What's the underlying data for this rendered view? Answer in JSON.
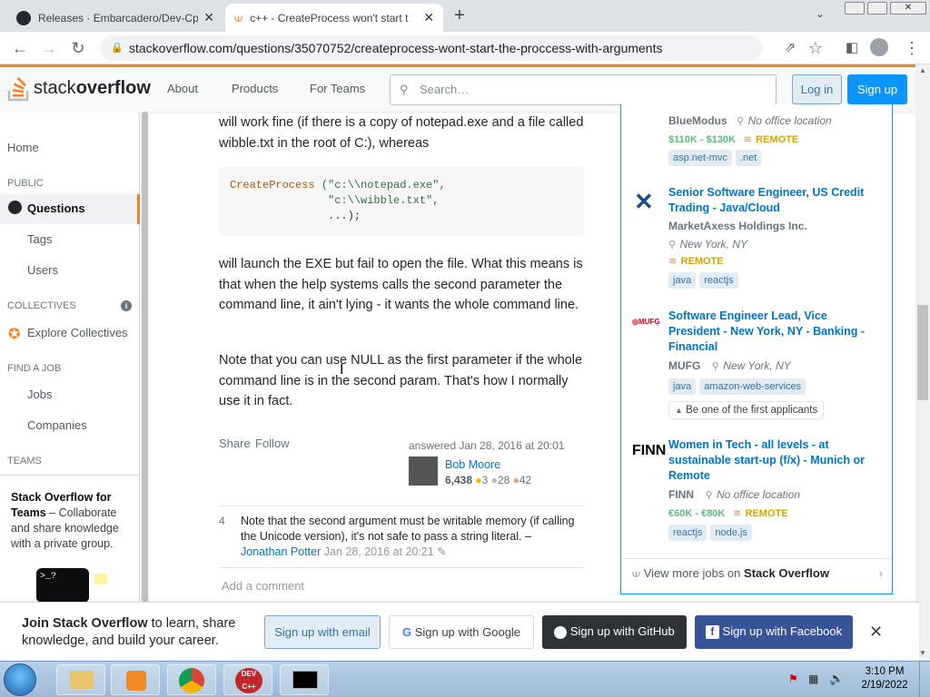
{
  "browser": {
    "tabs": [
      {
        "title": "Releases · Embarcadero/Dev-Cpp"
      },
      {
        "title": "c++ - CreateProcess won't start t"
      }
    ],
    "url": "stackoverflow.com/questions/35070752/createprocess-wont-start-the-proccess-with-arguments"
  },
  "so_header": {
    "logo_a": "stack",
    "logo_b": "overflow",
    "nav": [
      "About",
      "Products",
      "For Teams"
    ],
    "search_placeholder": "Search…",
    "login": "Log in",
    "signup": "Sign up"
  },
  "left_nav": {
    "home": "Home",
    "public": "PUBLIC",
    "questions": "Questions",
    "tags": "Tags",
    "users": "Users",
    "collectives": "COLLECTIVES",
    "explore": "Explore Collectives",
    "find_job": "FIND A JOB",
    "jobs": "Jobs",
    "companies": "Companies",
    "teams": "TEAMS",
    "teams_title": "Stack Overflow for Teams",
    "teams_desc": " – Collaborate and share knowledge with a private group."
  },
  "answer": {
    "p1": "will work fine (if there is a copy of notepad.exe and a file called wibble.txt in the root of C:), whereas",
    "code_fn": "CreateProcess",
    "code_l1": " (\"c:\\\\notepad.exe\",",
    "code_l2": "               \"c:\\\\wibble.txt\",",
    "code_l3": "               ...);",
    "p2": "will launch the EXE but fail to open the file. What this means is that when the help systems calls the second parameter the command line, it ain't lying - it wants the whole command line.",
    "p3": "Note that you can use NULL as the first parameter if the whole command line is in the second param. That's how I normally use it in fact.",
    "share": "Share",
    "follow": "Follow",
    "answered": "answered Jan 28, 2016 at 20:01",
    "author": "Bob Moore",
    "rep": "6,438",
    "gold": "3",
    "silver": "28",
    "bronze": "42"
  },
  "comment": {
    "score": "4",
    "text": "Note that the second argument must be writable memory (if calling the Unicode version), it's not safe to pass a string literal. –",
    "author": "Jonathan Potter",
    "date": "Jan 28, 2016 at 20:21",
    "add": "Add a comment"
  },
  "jobs": [
    {
      "title": "",
      "company": "BlueModus",
      "location": "No office location",
      "salary": "$110K - $130K",
      "remote": "REMOTE",
      "tags": [
        "asp.net-mvc",
        ".net"
      ]
    },
    {
      "title": "Senior Software Engineer, US Credit Trading - Java/Cloud",
      "company": "MarketAxess Holdings Inc.",
      "location": "New York, NY",
      "salary": "",
      "remote": "REMOTE",
      "tags": [
        "java",
        "reactjs"
      ]
    },
    {
      "title": "Software Engineer Lead, Vice President - New York, NY - Banking - Financial",
      "company": "MUFG",
      "location": "New York, NY",
      "salary": "",
      "remote": "",
      "tags": [
        "java",
        "amazon-web-services"
      ],
      "note": "Be one of the first applicants"
    },
    {
      "title": "Women in Tech - all levels - at sustainable start-up (f/x) - Munich or Remote",
      "company": "FINN",
      "location": "No office location",
      "salary": "€60K - €80K",
      "remote": "REMOTE",
      "tags": [
        "reactjs",
        "node.js"
      ]
    }
  ],
  "jobs_logos": {
    "mufg": "MUFG",
    "finn": "FINN"
  },
  "view_more": "View more jobs on",
  "view_more_b": "Stack Overflow",
  "banner": {
    "join_b": "Join Stack Overflow",
    "join_rest": " to learn, share knowledge, and build your career.",
    "email": "Sign up with email",
    "google": "Sign up with Google",
    "github": "Sign up with GitHub",
    "facebook": "Sign up with Facebook"
  },
  "taskbar": {
    "time": "3:10 PM",
    "date": "2/19/2022",
    "devcpp": "DEV C++"
  }
}
